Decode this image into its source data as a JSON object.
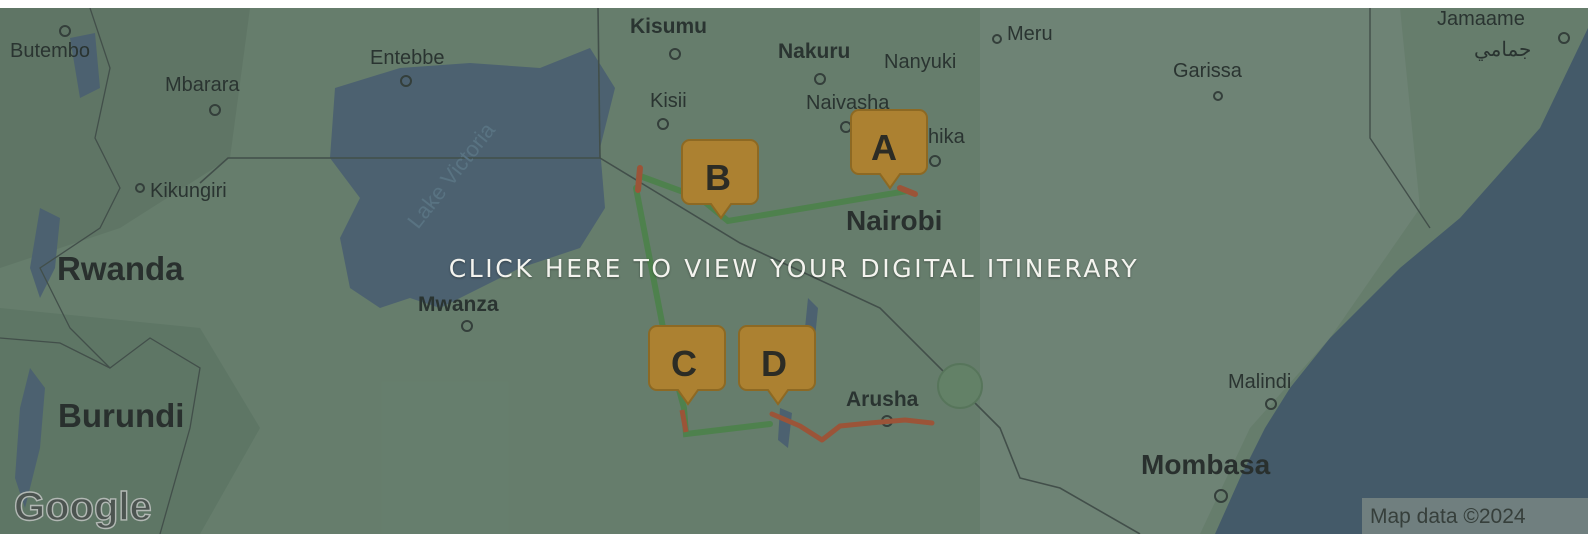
{
  "cta": {
    "label": "CLICK HERE TO VIEW YOUR DIGITAL ITINERARY"
  },
  "places": {
    "kisumu": "Kisumu",
    "meru": "Meru",
    "jamaame": "Jamaame",
    "jamaame_ar": "جمامي",
    "butembo": "Butembo",
    "entebbe": "Entebbe",
    "nakuru": "Nakuru",
    "nanyuki": "Nanyuki",
    "garissa": "Garissa",
    "mbarara": "Mbarara",
    "kisii": "Kisii",
    "naivasha": "Naivasha",
    "thika": "hika",
    "nairobi": "Nairobi",
    "kikungiri": "Kikungiri",
    "rwanda": "Rwanda",
    "mwanza": "Mwanza",
    "arusha": "Arusha",
    "malindi": "Malindi",
    "burundi": "Burundi",
    "mombasa": "Mombasa",
    "lake_victoria": "Lake Victoria"
  },
  "markers": [
    {
      "letter": "A"
    },
    {
      "letter": "B"
    },
    {
      "letter": "C"
    },
    {
      "letter": "D"
    }
  ],
  "attribution": {
    "logo": "Google",
    "map_data": "Map data ©2024"
  },
  "colors": {
    "land": "#8aa98f",
    "water": "#5a7489",
    "route_green": "#5aa154",
    "route_red": "#c8623c",
    "marker": "#e0a033",
    "overlay": "rgba(40,52,48,0.28)"
  }
}
